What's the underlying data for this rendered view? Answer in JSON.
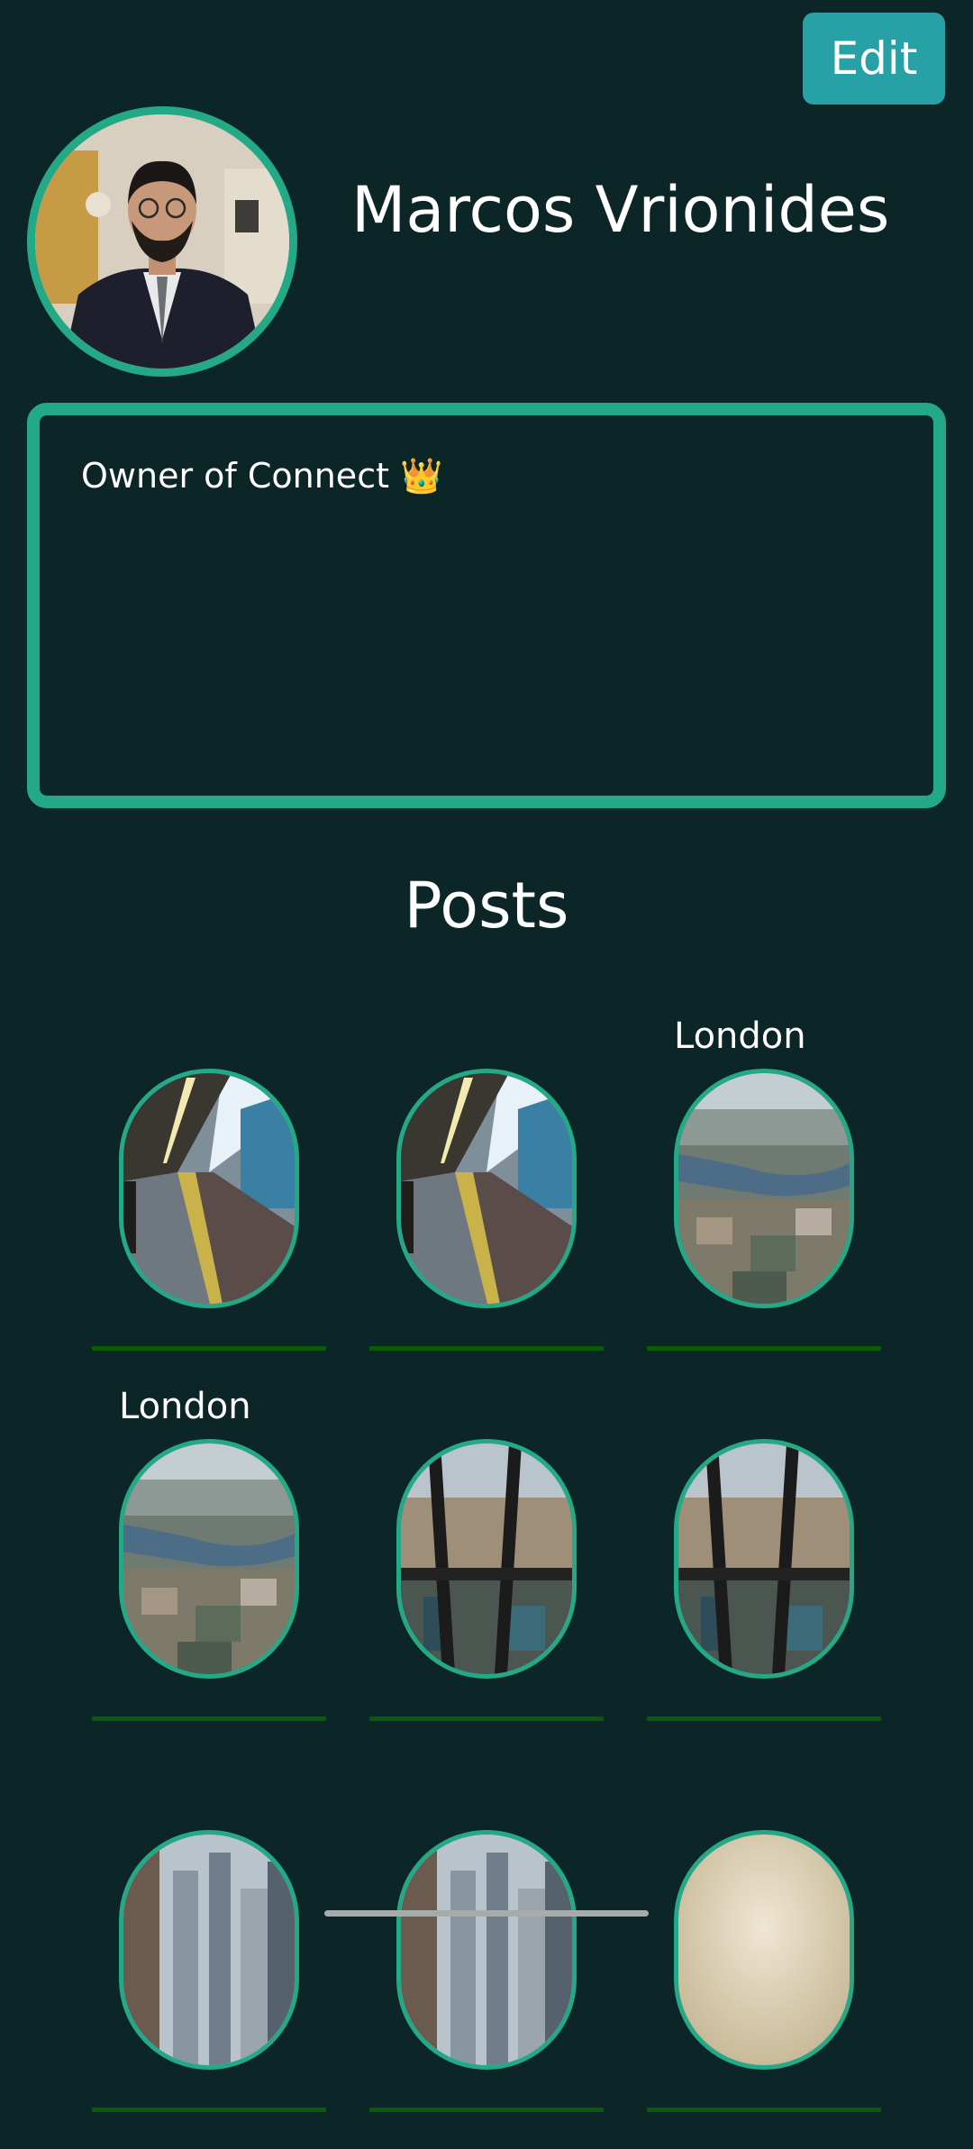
{
  "profile": {
    "edit_label": "Edit",
    "name": "Marcos Vrionides",
    "avatar_icon": "profile-photo",
    "bio": "Owner of Connect 👑"
  },
  "posts": {
    "heading": "Posts",
    "items": [
      {
        "location": "",
        "image": "train-platform"
      },
      {
        "location": "",
        "image": "train-platform"
      },
      {
        "location": "London",
        "image": "london-aerial-river"
      },
      {
        "location": "London",
        "image": "london-aerial-river"
      },
      {
        "location": "",
        "image": "skyscraper-window-view"
      },
      {
        "location": "",
        "image": "skyscraper-window-view"
      },
      {
        "location": "",
        "image": "city-street-buildings"
      },
      {
        "location": "",
        "image": "city-street-buildings"
      },
      {
        "location": "",
        "image": "hazy-sky"
      }
    ]
  },
  "colors": {
    "background": "#0c2627",
    "accent": "#24a987",
    "edit_button": "#27a1a6",
    "divider": "#0b5a0b"
  }
}
